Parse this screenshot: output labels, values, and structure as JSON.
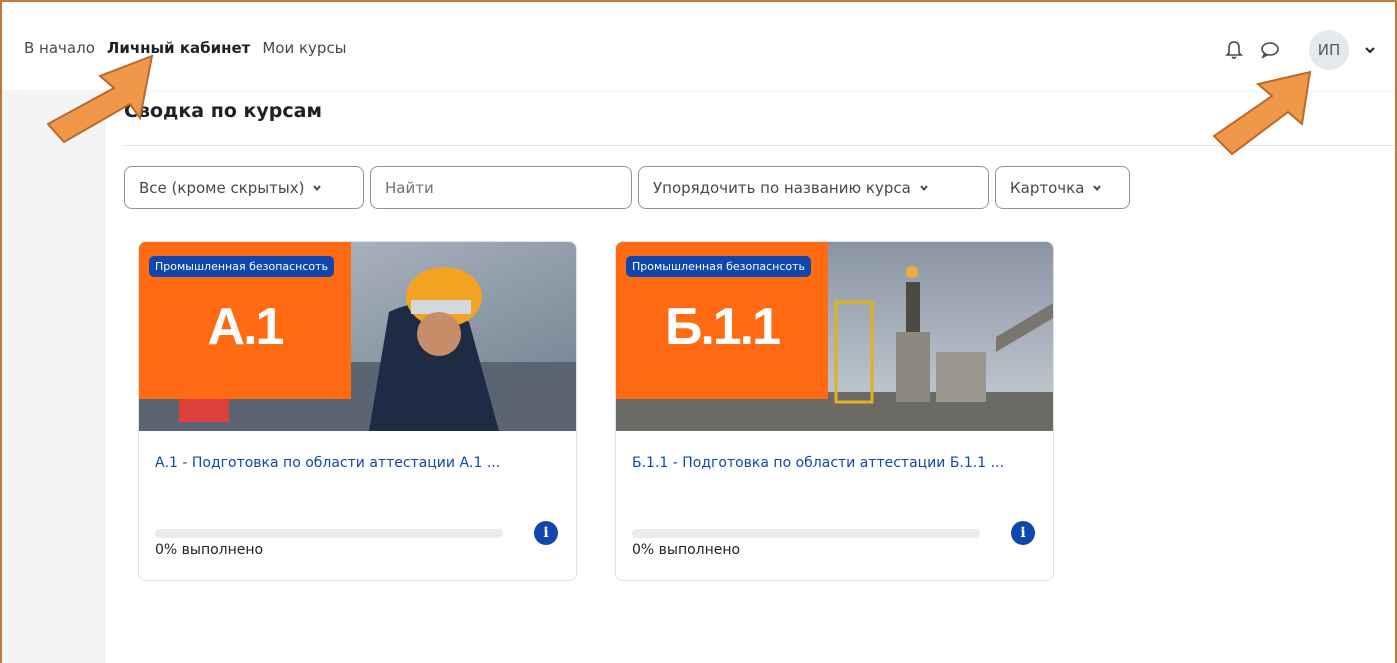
{
  "nav": {
    "home": "В начало",
    "dashboard": "Личный кабинет",
    "my_courses": "Мои курсы"
  },
  "user": {
    "initials": "ИП"
  },
  "icons": {
    "notifications": "bell-icon",
    "messages": "chat-bubble-icon",
    "user_menu": "chevron-down-icon",
    "info": "info-icon"
  },
  "main": {
    "title": "Сводка по курсам",
    "filter": {
      "label": "Все (кроме скрытых)"
    },
    "search": {
      "placeholder": "Найти"
    },
    "sort": {
      "label": "Упорядочить по названию курса"
    },
    "view": {
      "label": "Карточка"
    }
  },
  "courses": [
    {
      "category": "Промышленная безопаснсоть",
      "code": "А.1",
      "title": "А.1 - Подготовка по области аттестации А.1 ...",
      "progress_percent": 0,
      "progress_text": "0% выполнено"
    },
    {
      "category": "Промышленная безопаснсоть",
      "code": "Б.1.1",
      "title": "Б.1.1 - Подготовка по области аттестации Б.1.1 ...",
      "progress_percent": 0,
      "progress_text": "0% выполнено"
    }
  ],
  "colors": {
    "accent": "#0f47ad",
    "badge_orange": "#ff6a13",
    "annotation_arrow": "#f0974a"
  }
}
